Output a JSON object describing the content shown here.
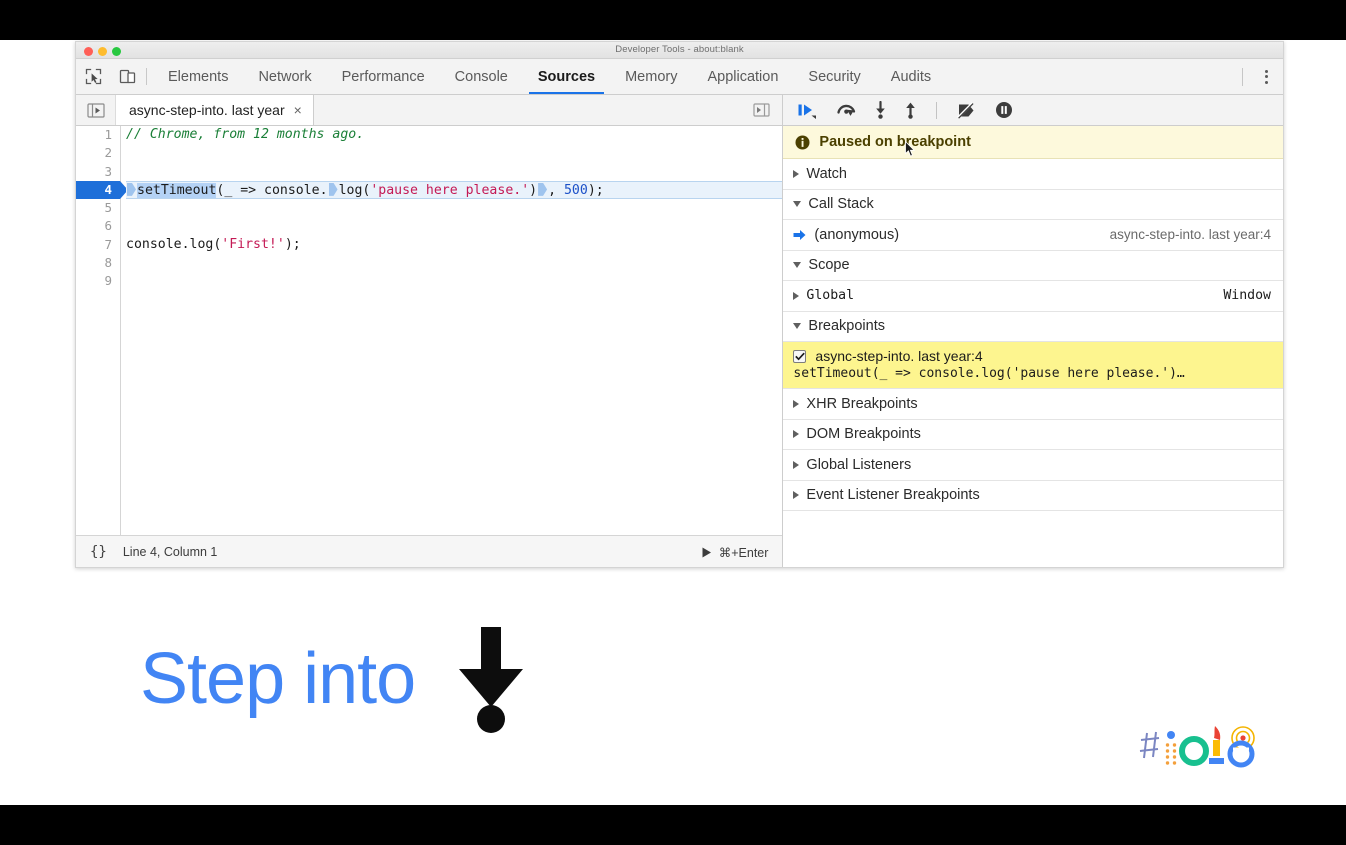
{
  "window": {
    "title": "Developer Tools - about:blank",
    "traffic_lights": [
      "close-red",
      "minimize-yellow",
      "maximize-green"
    ]
  },
  "toolbar": {
    "inspect_icon": "inspect-element-icon",
    "device_icon": "device-toolbar-icon",
    "kebab_icon": "more-options-icon",
    "tabs": [
      {
        "label": "Elements",
        "active": false
      },
      {
        "label": "Network",
        "active": false
      },
      {
        "label": "Performance",
        "active": false
      },
      {
        "label": "Console",
        "active": false
      },
      {
        "label": "Sources",
        "active": true
      },
      {
        "label": "Memory",
        "active": false
      },
      {
        "label": "Application",
        "active": false
      },
      {
        "label": "Security",
        "active": false
      },
      {
        "label": "Audits",
        "active": false
      }
    ]
  },
  "sources": {
    "nav_toggle_icon": "show-navigator-icon",
    "panel_toggle_icon": "show-debugger-icon",
    "file_tab": {
      "label": "async-step-into. last year",
      "close": "×"
    },
    "code_lines": [
      {
        "n": "1",
        "text": "// Chrome, from 12 months ago."
      },
      {
        "n": "2",
        "text": ""
      },
      {
        "n": "3",
        "text": ""
      },
      {
        "n": "4",
        "text": "setTimeout(_ => console.log('pause here please.'), 500);"
      },
      {
        "n": "5",
        "text": ""
      },
      {
        "n": "6",
        "text": ""
      },
      {
        "n": "7",
        "text": "console.log('First!');"
      },
      {
        "n": "8",
        "text": ""
      },
      {
        "n": "9",
        "text": ""
      }
    ],
    "line4": {
      "selected_call": "setTimeout",
      "args_before": "(_ => console.",
      "call2": "log",
      "paren": "(",
      "string": "'pause here please.'",
      "close": ")",
      "tail": ", ",
      "delay": "500",
      "end": ");"
    },
    "line1_comment": "// Chrome, from 12 months ago.",
    "line7": {
      "prefix": "console.log(",
      "string": "'First!'",
      "suffix": ");"
    },
    "status": {
      "format_icon": "{}",
      "position": "Line 4, Column 1",
      "run_icon": "run-snippet-icon",
      "run_shortcut": "⌘+Enter"
    }
  },
  "debugger": {
    "buttons": [
      {
        "name": "resume-script-execution",
        "icon": "resume-icon"
      },
      {
        "name": "step-over-next-function-call",
        "icon": "step-over-icon"
      },
      {
        "name": "step-into-next-function-call",
        "icon": "step-into-icon"
      },
      {
        "name": "step-out-of-current-function",
        "icon": "step-out-icon"
      },
      {
        "name": "deactivate-breakpoints",
        "icon": "deactivate-breakpoints-icon"
      },
      {
        "name": "pause-on-exceptions",
        "icon": "pause-on-exceptions-icon"
      }
    ],
    "paused_banner": {
      "icon": "info-icon",
      "text": "Paused on breakpoint"
    },
    "watch": {
      "label": "Watch",
      "expanded": false
    },
    "call_stack": {
      "label": "Call Stack",
      "expanded": true,
      "frames": [
        {
          "name": "(anonymous)",
          "location": "async-step-into. last year:4",
          "current": true
        }
      ]
    },
    "scope": {
      "label": "Scope",
      "expanded": true,
      "entries": [
        {
          "name": "Global",
          "value": "Window",
          "expanded": false
        }
      ]
    },
    "breakpoints": {
      "label": "Breakpoints",
      "expanded": true,
      "items": [
        {
          "checked": true,
          "location": "async-step-into. last year:4",
          "snippet": "setTimeout(_ => console.log('pause here please.')…"
        }
      ]
    },
    "other_sections": [
      {
        "label": "XHR Breakpoints",
        "expanded": false
      },
      {
        "label": "DOM Breakpoints",
        "expanded": false
      },
      {
        "label": "Global Listeners",
        "expanded": false
      },
      {
        "label": "Event Listener Breakpoints",
        "expanded": false
      }
    ]
  },
  "caption": {
    "text": "Step into",
    "icon": "step-into-arrow-icon",
    "color": "#4285f4"
  },
  "branding": {
    "logo": "google-io-18-logo",
    "text": "#io18"
  },
  "colors": {
    "accent_blue": "#1a73e8",
    "caption_blue": "#4285f4",
    "paused_yellow": "#fdf9dc",
    "breakpoint_yellow": "#fdf58f",
    "highlight_line": "#e9f2fb",
    "comment_green": "#1a7f37",
    "string_red": "#c41a55",
    "number_blue": "#1b50c8"
  }
}
